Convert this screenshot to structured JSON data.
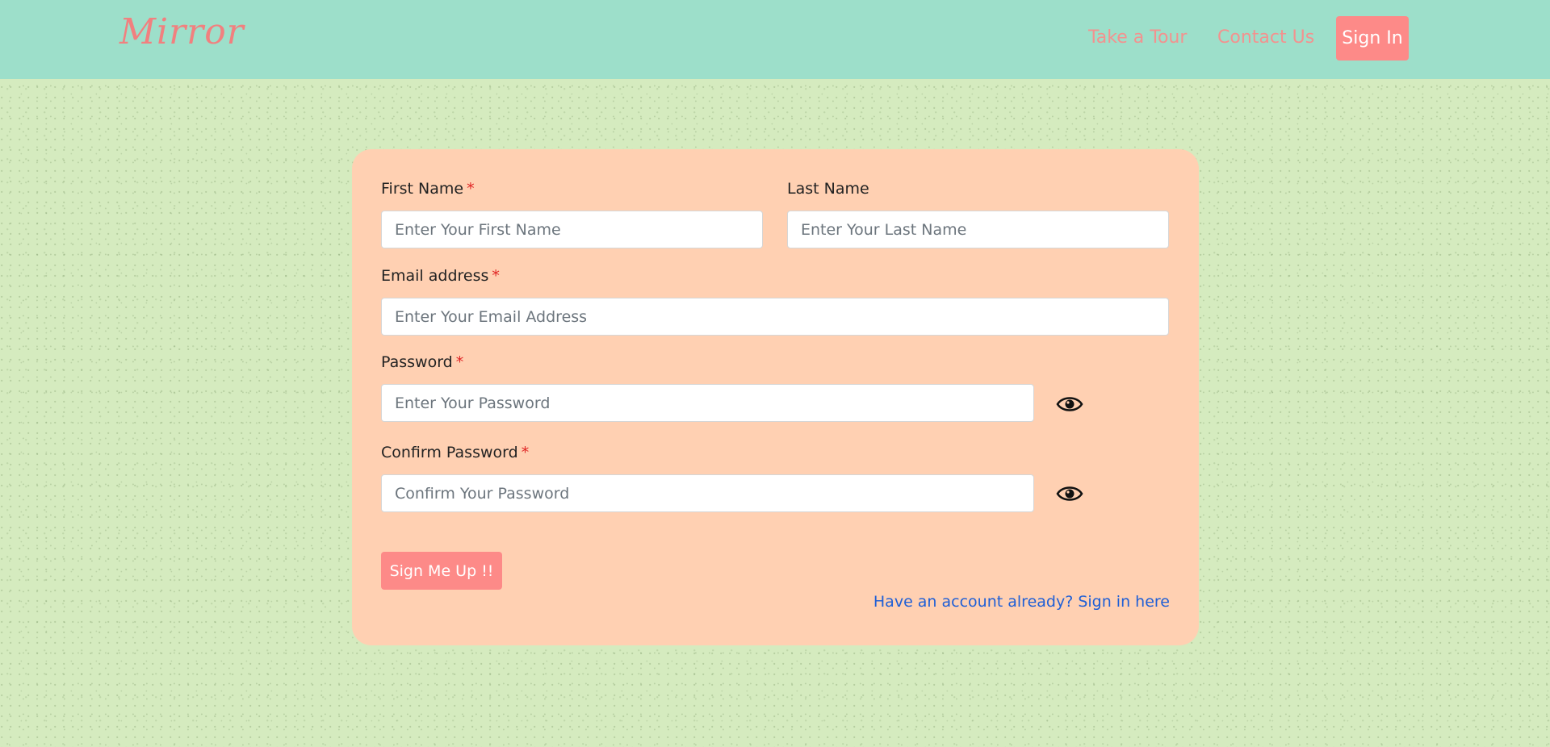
{
  "navbar": {
    "brand": "Mirror",
    "links": [
      {
        "label": "Take a Tour"
      },
      {
        "label": "Contact Us"
      }
    ],
    "signin_label": "Sign In"
  },
  "form": {
    "first_name": {
      "label": "First Name",
      "required": "*",
      "placeholder": "Enter Your First Name"
    },
    "last_name": {
      "label": "Last Name",
      "placeholder": "Enter Your Last Name"
    },
    "email": {
      "label": "Email address",
      "required": "*",
      "placeholder": "Enter Your Email Address"
    },
    "password": {
      "label": "Password",
      "required": "*",
      "placeholder": "Enter Your Password"
    },
    "confirm_password": {
      "label": "Confirm Password",
      "required": "*",
      "placeholder": "Confirm Your Password"
    },
    "submit_label": "Sign Me Up !!",
    "signin_link": "Have an account already? Sign in here"
  },
  "colors": {
    "navbar_bg": "#9ddfca",
    "page_bg": "#d5ebbf",
    "card_bg": "#ffd0b2",
    "accent": "#fd8a88",
    "link": "#1f5fd6",
    "required": "#e02424"
  },
  "icons": {
    "password_toggle": "eye-icon",
    "confirm_password_toggle": "eye-icon"
  }
}
